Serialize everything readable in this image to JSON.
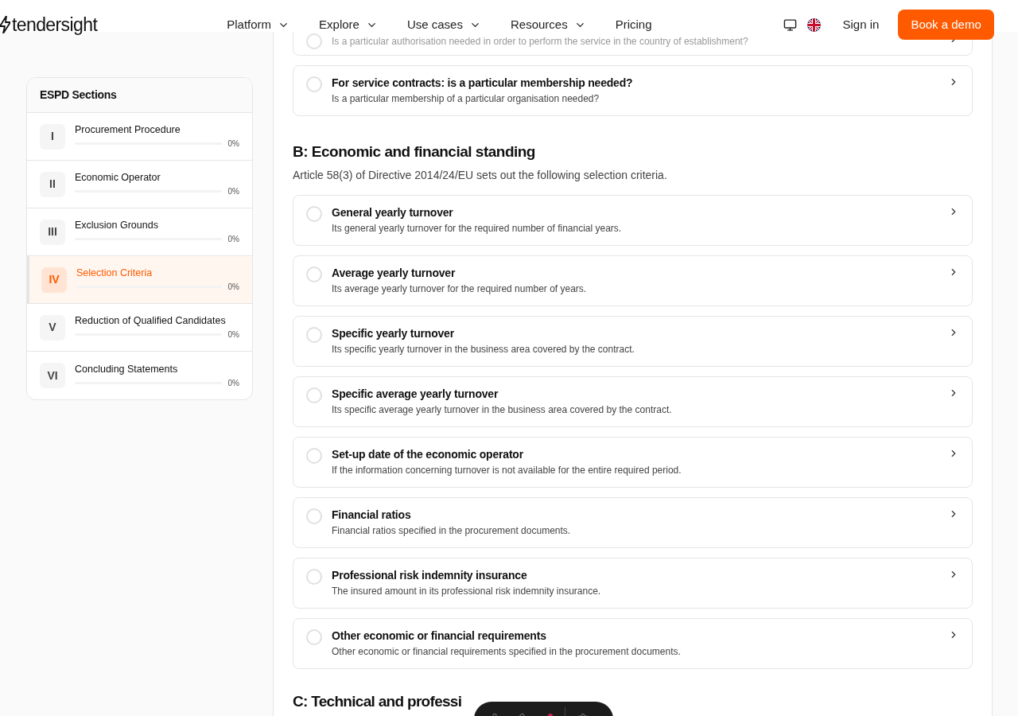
{
  "header": {
    "logo": "tendersight",
    "nav": [
      {
        "label": "Platform",
        "dropdown": true
      },
      {
        "label": "Explore",
        "dropdown": true
      },
      {
        "label": "Use cases",
        "dropdown": true
      },
      {
        "label": "Resources",
        "dropdown": true
      },
      {
        "label": "Pricing",
        "dropdown": false
      }
    ],
    "sign_in": "Sign in",
    "cta": "Book a demo"
  },
  "sidebar": {
    "title": "ESPD Sections",
    "items": [
      {
        "numeral": "I",
        "label": "Procurement Procedure",
        "percent": "0%",
        "selected": false
      },
      {
        "numeral": "II",
        "label": "Economic Operator",
        "percent": "0%",
        "selected": false
      },
      {
        "numeral": "III",
        "label": "Exclusion Grounds",
        "percent": "0%",
        "selected": false
      },
      {
        "numeral": "IV",
        "label": "Selection Criteria",
        "percent": "0%",
        "selected": true
      },
      {
        "numeral": "V",
        "label": "Reduction of Qualified Candidates",
        "percent": "0%",
        "selected": false
      },
      {
        "numeral": "VI",
        "label": "Concluding Statements",
        "percent": "0%",
        "selected": false
      }
    ]
  },
  "top_criteria": [
    {
      "description": "Is a particular authorisation needed in order to perform the service in the country of establishment?",
      "done": false
    },
    {
      "title": "For service contracts: is a particular membership needed?",
      "description": "Is a particular membership of a particular organisation needed?",
      "done": false
    }
  ],
  "section_b": {
    "heading": "B: Economic and financial standing",
    "intro": "Article 58(3) of Directive 2014/24/EU sets out the following selection criteria.",
    "criteria": [
      {
        "title": "General yearly turnover",
        "description": "Its general yearly turnover for the required number of financial years.",
        "done": false
      },
      {
        "title": "Average yearly turnover",
        "description": "Its average yearly turnover for the required number of years.",
        "done": false
      },
      {
        "title": "Specific yearly turnover",
        "description": "Its specific yearly turnover in the business area covered by the contract.",
        "done": false
      },
      {
        "title": "Specific average yearly turnover",
        "description": "Its specific average yearly turnover in the business area covered by the contract.",
        "done": false
      },
      {
        "title": "Set-up date of the economic operator",
        "description": "If the information concerning turnover is not available for the entire required period.",
        "done": false
      },
      {
        "title": "Financial ratios",
        "description": "Financial ratios specified in the procurement documents.",
        "done": false
      },
      {
        "title": "Professional risk indemnity insurance",
        "description": "The insured amount in its professional risk indemnity insurance.",
        "done": false
      },
      {
        "title": "Other economic or financial requirements",
        "description": "Other economic or financial requirements specified in the procurement documents.",
        "done": false
      }
    ]
  },
  "section_c": {
    "heading": "C: Technical and professi"
  }
}
